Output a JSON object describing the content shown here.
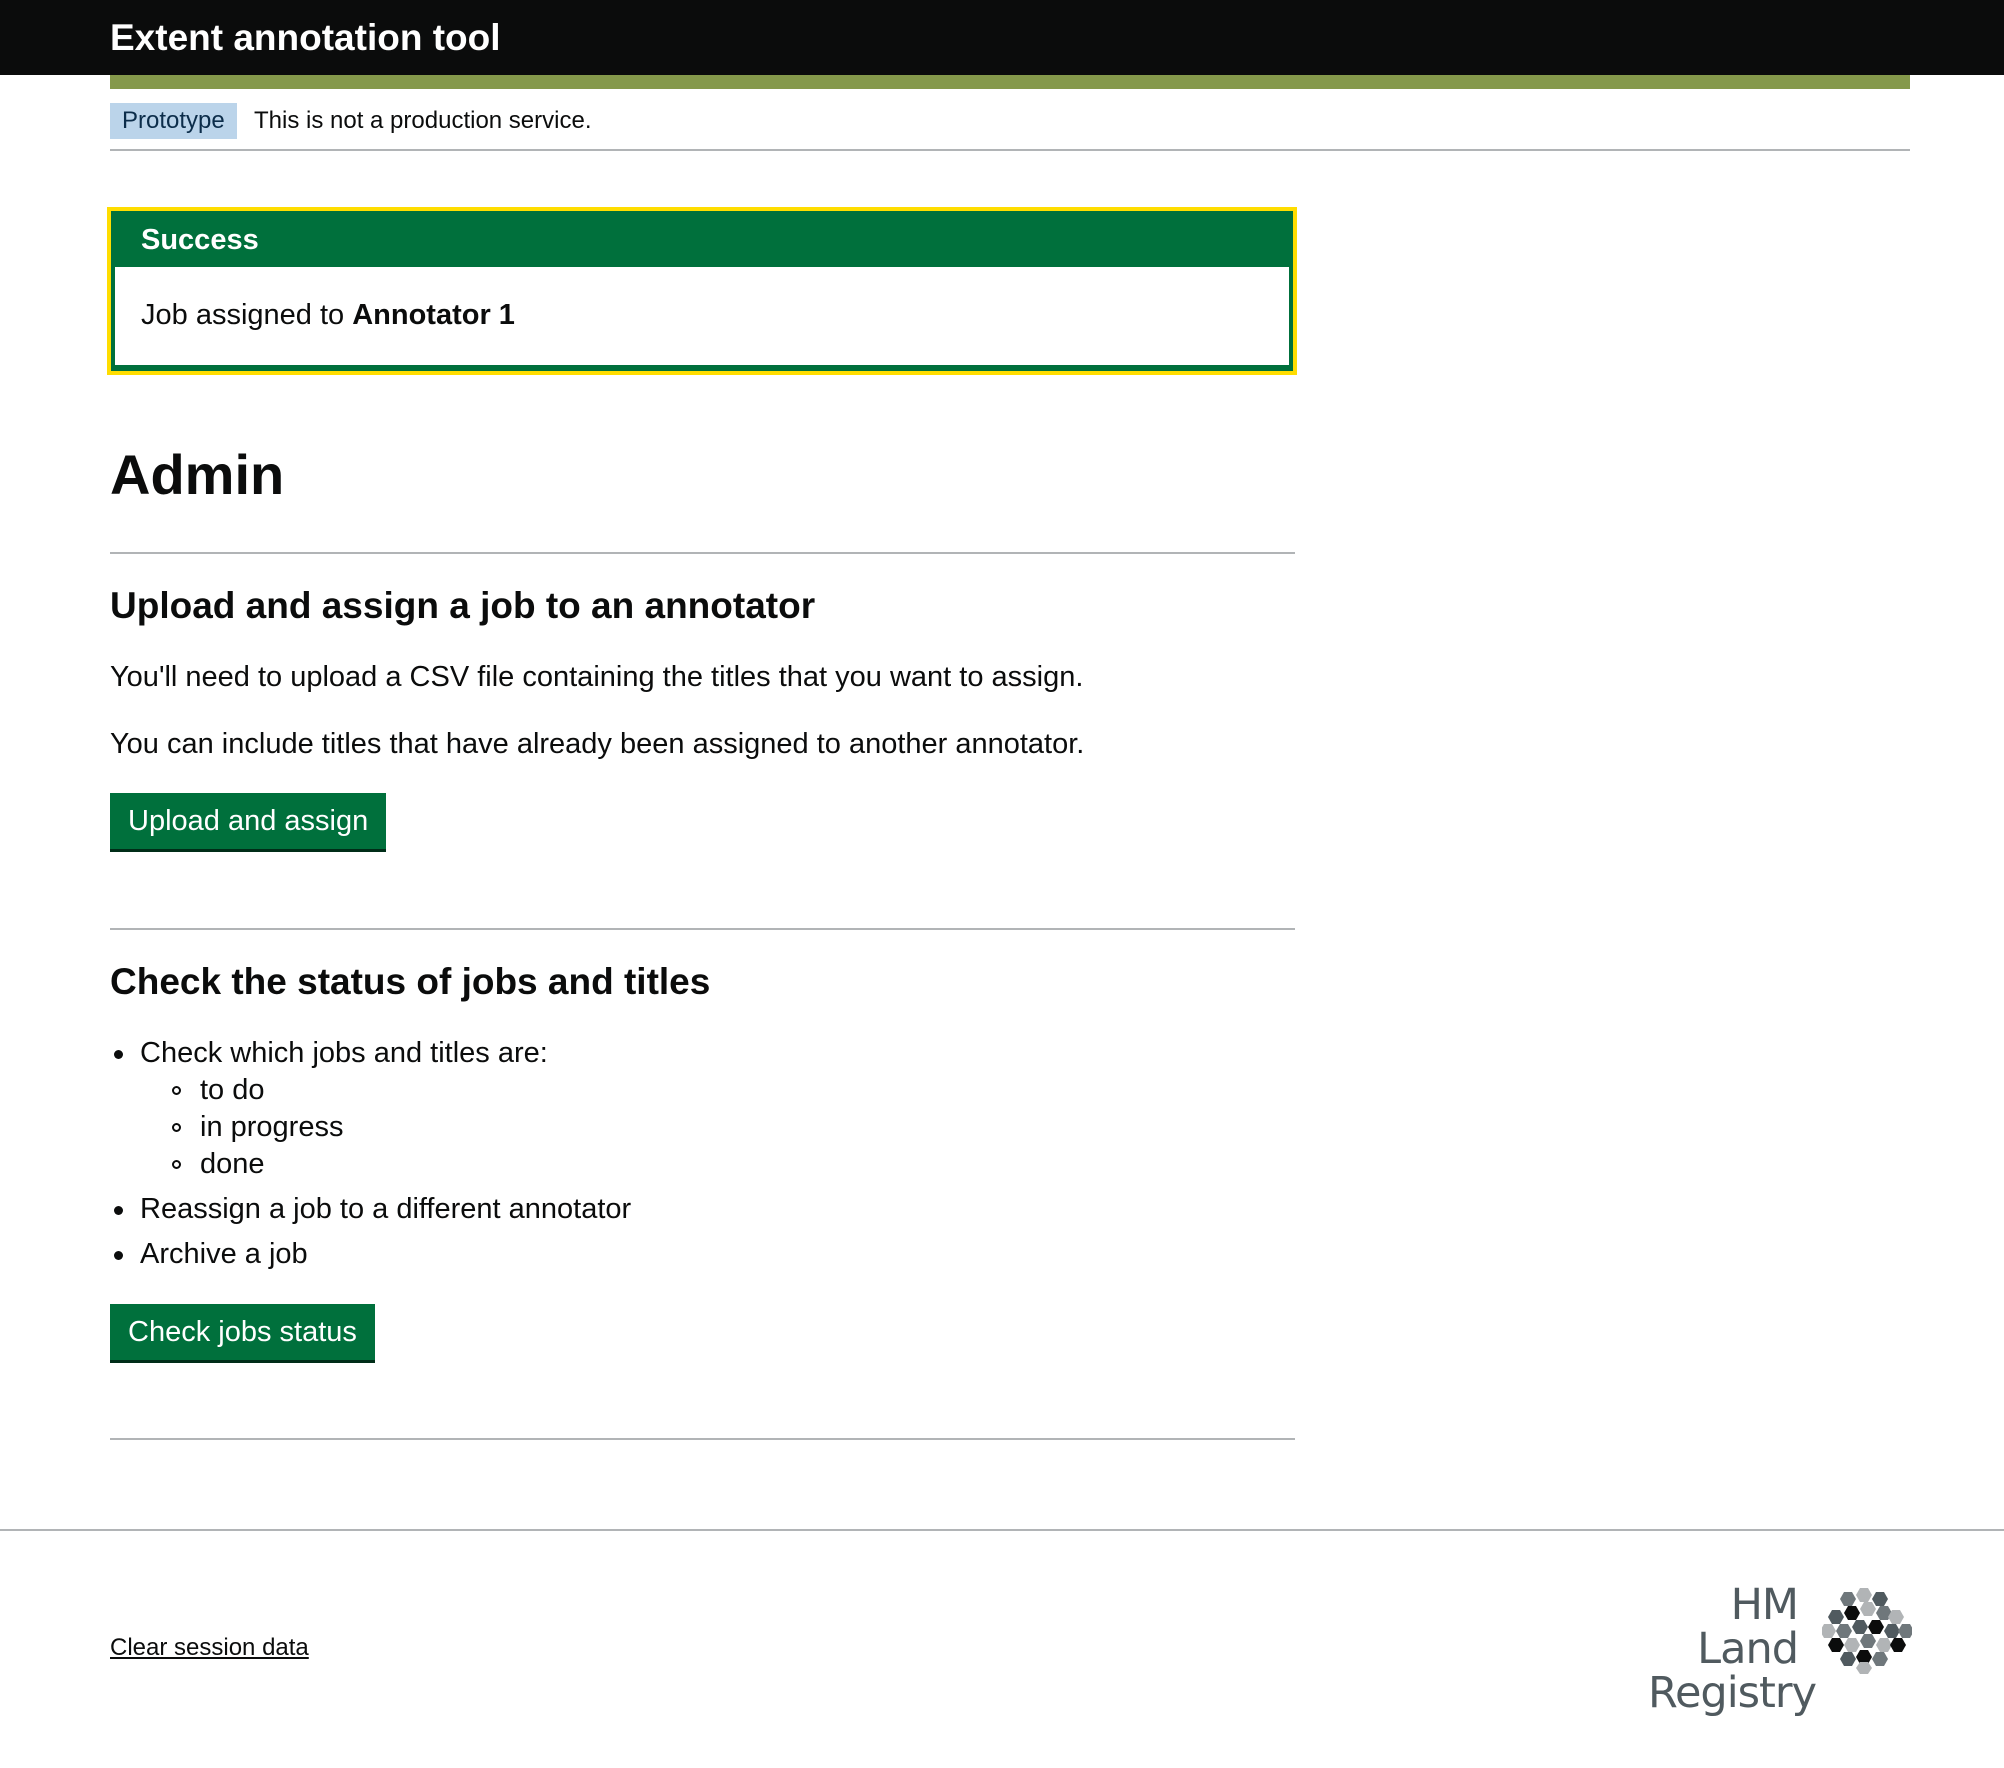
{
  "header": {
    "title": "Extent annotation tool"
  },
  "phase_banner": {
    "tag": "Prototype",
    "text": "This is not a production service."
  },
  "notification": {
    "title": "Success",
    "message_prefix": "Job assigned to ",
    "message_bold": "Annotator 1"
  },
  "page": {
    "title": "Admin"
  },
  "upload_section": {
    "heading": "Upload and assign a job to an annotator",
    "paragraph_1": "You'll need to upload a CSV file containing the titles that you want to assign.",
    "paragraph_2": "You can include titles that have already been assigned to another annotator.",
    "button_label": "Upload and assign"
  },
  "status_section": {
    "heading": "Check the status of jobs and titles",
    "items": [
      "Check which jobs and titles are:",
      "Reassign a job to a different annotator",
      "Archive a job"
    ],
    "subitems": [
      "to do",
      "in progress",
      "done"
    ],
    "button_label": "Check jobs status"
  },
  "footer": {
    "link_label": "Clear session data",
    "logo_line_1": "HM Land",
    "logo_line_2": "Registry"
  },
  "colors": {
    "header_bg": "#0b0c0c",
    "accent_stripe": "#85994b",
    "button_green": "#00703c",
    "focus_yellow": "#ffdd00",
    "phase_tag_bg": "#bbd4ea"
  }
}
